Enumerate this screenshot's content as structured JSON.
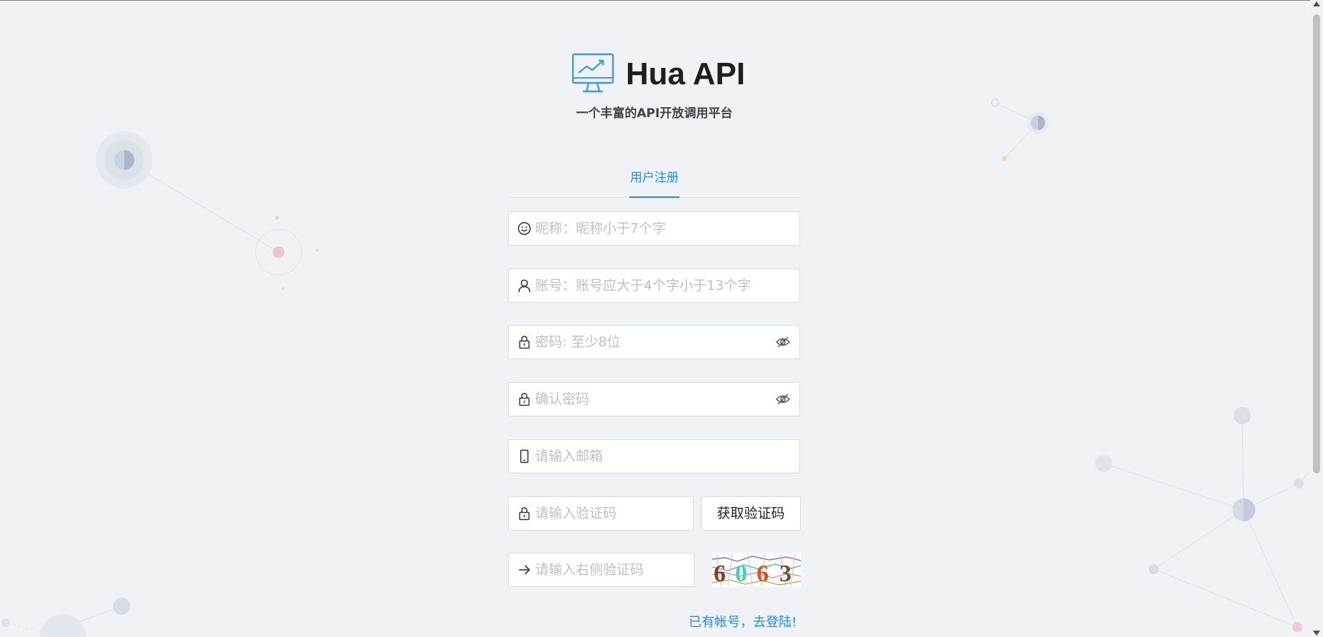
{
  "app": {
    "title": "Hua API",
    "subtitle": "一个丰富的API开放调用平台",
    "logo_icon": "monitor-trending-up-icon"
  },
  "tabs": [
    {
      "label": "用户注册",
      "active": true
    }
  ],
  "form": {
    "nickname": {
      "placeholder": "昵称：昵称小于7个字",
      "icon": "smile-icon"
    },
    "account": {
      "placeholder": "账号：账号应大于4个字小于13个字",
      "icon": "user-icon"
    },
    "password": {
      "placeholder": "密码: 至少8位",
      "icon": "lock-icon",
      "toggle_icon": "eye-invisible-icon"
    },
    "confirm_password": {
      "placeholder": "确认密码",
      "icon": "lock-icon",
      "toggle_icon": "eye-invisible-icon"
    },
    "email": {
      "placeholder": "请输入邮箱",
      "icon": "mobile-icon"
    },
    "email_code": {
      "placeholder": "请输入验证码",
      "icon": "lock-icon"
    },
    "send_code_label": "获取验证码",
    "captcha": {
      "placeholder": "请输入右侧验证码",
      "icon": "arrow-right-icon",
      "image_text": "6063"
    },
    "login_link": "已有帐号，去登陆!"
  },
  "colors": {
    "accent": "#1890ff",
    "background": "#f0f2f5"
  }
}
